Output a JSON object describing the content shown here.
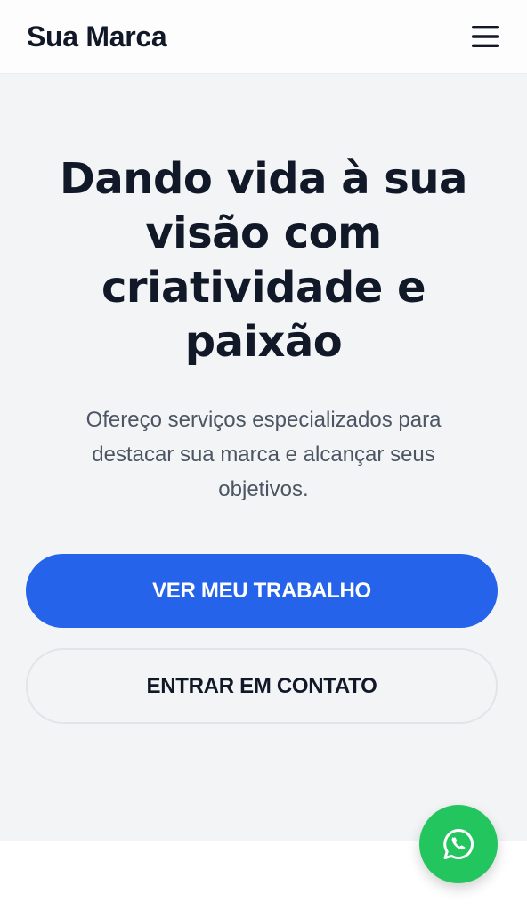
{
  "header": {
    "brand": "Sua Marca",
    "menu_icon": "hamburger-menu-icon"
  },
  "hero": {
    "title": "Dando vida à sua visão com criatividade e paixão",
    "subtitle": "Ofereço serviços especializados para destacar sua marca e alcançar seus objetivos.",
    "primary_button": "VER MEU TRABALHO",
    "secondary_button": "ENTRAR EM CONTATO"
  },
  "floating": {
    "icon": "whatsapp-icon"
  },
  "colors": {
    "primary": "#2563eb",
    "whatsapp": "#22c55e",
    "hero_bg": "#f3f4f6",
    "text_dark": "#111827",
    "text_muted": "#4b5563"
  }
}
